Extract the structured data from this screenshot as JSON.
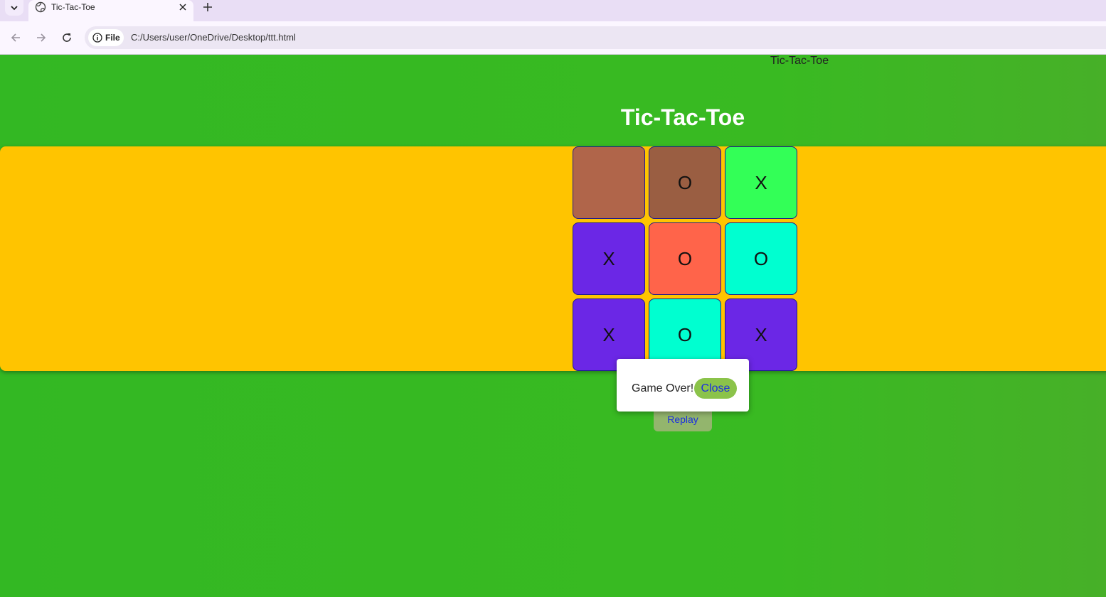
{
  "browser": {
    "tab_title": "Tic-Tac-Toe",
    "new_tab": "+",
    "site_chip": "File",
    "url": "C:/Users/user/OneDrive/Desktop/ttt.html"
  },
  "page": {
    "doc_title": "Tic-Tac-Toe",
    "heading": "Tic-Tac-Toe",
    "board": [
      {
        "mark": "",
        "color": "#b0654a"
      },
      {
        "mark": "O",
        "color": "#9a5e42"
      },
      {
        "mark": "X",
        "color": "#33ff57"
      },
      {
        "mark": "X",
        "color": "#6b27e6"
      },
      {
        "mark": "O",
        "color": "#ff644a"
      },
      {
        "mark": "O",
        "color": "#00ffd0"
      },
      {
        "mark": "X",
        "color": "#6b27e6"
      },
      {
        "mark": "O",
        "color": "#00ffd0"
      },
      {
        "mark": "X",
        "color": "#6b27e6"
      }
    ],
    "replay_label": "Replay"
  },
  "modal": {
    "message": "Game Over!",
    "close_label": "Close"
  },
  "colors": {
    "background": "#33b823",
    "banner": "#ffc400",
    "heading": "#ffffff",
    "button_text": "#1a2ee0",
    "close_button": "#8bc34a",
    "replay_button": "#93b56d"
  }
}
